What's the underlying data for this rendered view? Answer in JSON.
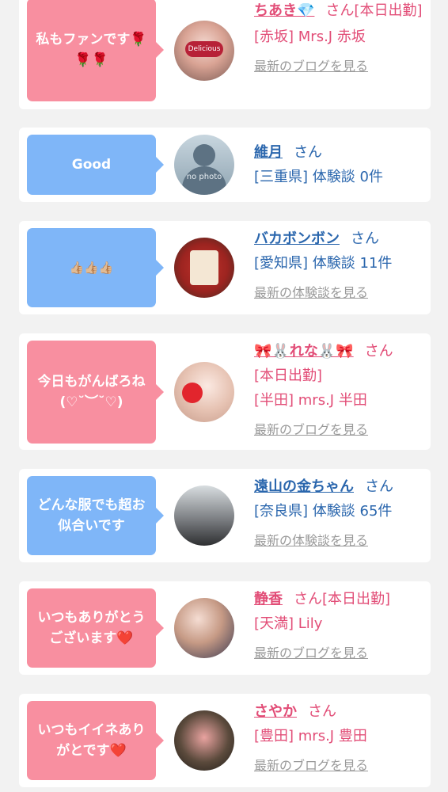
{
  "cards": [
    {
      "message": "私もファンです🌹\n🌹🌹",
      "name": "ちあき💎",
      "suffix": "さん[本日出勤]",
      "sub": "[赤坂] Mrs.J 赤坂",
      "link": "最新のブログを見る"
    },
    {
      "message": "Good",
      "name": "維月",
      "suffix": "さん",
      "sub": "[三重県] 体験談 0件",
      "link": "",
      "avatar_text": "no photo"
    },
    {
      "message": "👍🏼👍🏼👍🏼",
      "name": "バカボンボン",
      "suffix": "さん",
      "sub": "[愛知県] 体験談 11件",
      "link": "最新の体験談を見る"
    },
    {
      "message": "今日もがんばろね\n(♡˘︶˘♡)",
      "name": "🎀🐰れな🐰🎀",
      "suffix": "さん",
      "sub1": "[本日出勤]",
      "sub": "[半田] mrs.J 半田",
      "link": "最新のブログを見る"
    },
    {
      "message": "どんな服でも超お\n似合いです",
      "name": "遠山の金ちゃん",
      "suffix": "さん",
      "sub": "[奈良県] 体験談 65件",
      "link": "最新の体験談を見る"
    },
    {
      "message": "いつもありがとう\nございます❤️",
      "name": "静香",
      "suffix": "さん[本日出勤]",
      "sub": "[天満] Lily",
      "link": "最新のブログを見る"
    },
    {
      "message": "いつもイイネあり\nがとです❤️",
      "name": "さやか",
      "suffix": "さん",
      "sub": "[豊田] mrs.J 豊田",
      "link": "最新のブログを見る"
    }
  ],
  "colors": {
    "pink_bubble": "#f88fa0",
    "blue_bubble": "#7fb6f8",
    "pink_text": "#e24d77",
    "blue_text": "#2a66ad"
  }
}
